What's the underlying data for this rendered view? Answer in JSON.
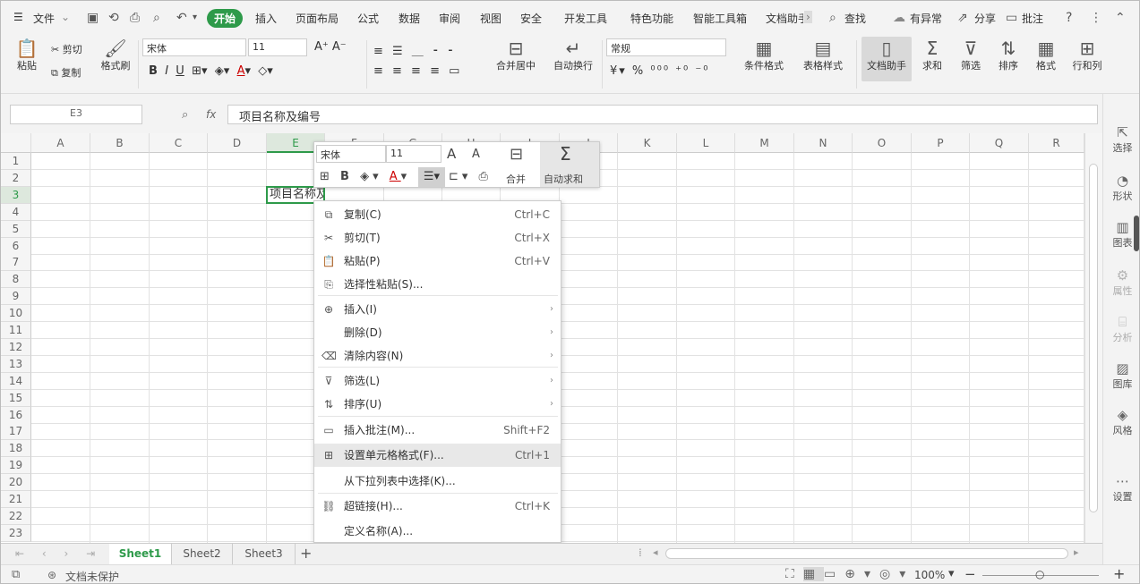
{
  "menubar": {
    "file_label": "文件",
    "tabs": [
      "开始",
      "插入",
      "页面布局",
      "公式",
      "数据",
      "审阅",
      "视图",
      "安全",
      "开发工具",
      "特色功能",
      "智能工具箱",
      "文档助手"
    ],
    "active_tab": "开始",
    "search_label": "查找",
    "comment_label": "有异常",
    "share_label": "分享",
    "batch_label": "批注"
  },
  "ribbon": {
    "paste": "粘贴",
    "cut": "剪切",
    "copy": "复制",
    "format_painter": "格式刷",
    "font_name": "宋体",
    "font_size": "11",
    "number_format": "常规",
    "merge": "合并居中",
    "wrap": "自动换行",
    "cond_format": "条件格式",
    "table_style": "表格样式",
    "doc_helper": "文档助手",
    "sum": "求和",
    "filter": "筛选",
    "sort": "排序",
    "format": "格式",
    "rows_cols": "行和列"
  },
  "formula_bar": {
    "name_box": "E3",
    "fx": "fx",
    "content": "项目名称及编号"
  },
  "grid": {
    "columns": [
      "A",
      "B",
      "C",
      "D",
      "E",
      "F",
      "G",
      "H",
      "I",
      "J",
      "K",
      "L",
      "M",
      "N",
      "O",
      "P",
      "Q",
      "R"
    ],
    "rows": [
      "1",
      "2",
      "3",
      "4",
      "5",
      "6",
      "7",
      "8",
      "9",
      "10",
      "11",
      "12",
      "13",
      "14",
      "15",
      "16",
      "17",
      "18",
      "19",
      "20",
      "21",
      "22",
      "23"
    ],
    "cell_e3": "项目名称及"
  },
  "mini_toolbar": {
    "font": "宋体",
    "size": "11",
    "merge": "合并",
    "autosum": "自动求和"
  },
  "context_menu": [
    {
      "label": "复制(C)",
      "shortcut": "Ctrl+C",
      "icon": "copy-icon"
    },
    {
      "label": "剪切(T)",
      "shortcut": "Ctrl+X",
      "icon": "scissors-icon"
    },
    {
      "label": "粘贴(P)",
      "shortcut": "Ctrl+V",
      "icon": "paste-icon"
    },
    {
      "label": "选择性粘贴(S)...",
      "shortcut": "",
      "icon": "paste-special-icon"
    },
    {
      "label": "插入(I)",
      "shortcut": "",
      "icon": "insert-icon",
      "submenu": true
    },
    {
      "label": "删除(D)",
      "shortcut": "",
      "icon": "",
      "submenu": true
    },
    {
      "label": "清除内容(N)",
      "shortcut": "",
      "icon": "eraser-icon",
      "submenu": true
    },
    {
      "label": "筛选(L)",
      "shortcut": "",
      "icon": "filter-icon",
      "submenu": true
    },
    {
      "label": "排序(U)",
      "shortcut": "",
      "icon": "sort-icon",
      "submenu": true
    },
    {
      "label": "插入批注(M)...",
      "shortcut": "Shift+F2",
      "icon": "comment-icon"
    },
    {
      "label": "设置单元格格式(F)...",
      "shortcut": "Ctrl+1",
      "icon": "format-cells-icon"
    },
    {
      "label": "从下拉列表中选择(K)...",
      "shortcut": "",
      "icon": ""
    },
    {
      "label": "超链接(H)...",
      "shortcut": "Ctrl+K",
      "icon": "link-icon"
    },
    {
      "label": "定义名称(A)...",
      "shortcut": "",
      "icon": ""
    }
  ],
  "side_panel": [
    "选择",
    "形状",
    "图表",
    "属性",
    "分析",
    "图库",
    "风格",
    "设置"
  ],
  "sheets": [
    "Sheet1",
    "Sheet2",
    "Sheet3"
  ],
  "status": {
    "protect": "文档未保护",
    "zoom": "100%"
  }
}
